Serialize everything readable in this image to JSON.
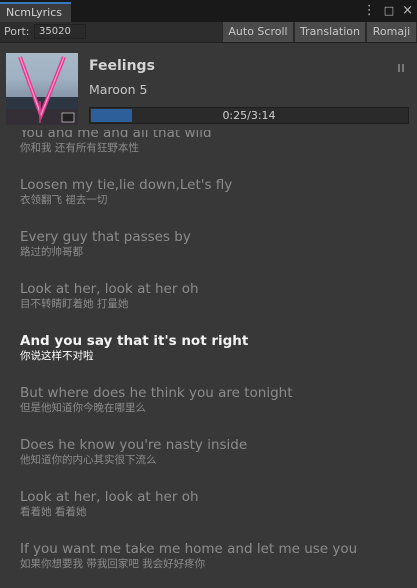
{
  "window": {
    "tab_title": "NcmLyrics"
  },
  "tab_tools": [
    "⋮",
    "□",
    "×"
  ],
  "toolbar": {
    "port_label": "Port:",
    "port_value": "35020",
    "buttons": [
      "Auto Scroll",
      "Translation",
      "Romaji"
    ]
  },
  "song": {
    "title": "Feelings",
    "artist": "Maroon 5",
    "progress_text": "0:25/3:14",
    "progress_fraction": 0.13,
    "cover_icon": "album-cover-art"
  },
  "lyrics": {
    "current_index": 4,
    "lines": [
      {
        "en": "You and me and all that wild",
        "zh": "你和我 还有所有狂野本性"
      },
      {
        "en": "Loosen my tie,lie down,Let's fly",
        "zh": "衣领翻飞 褪去一切"
      },
      {
        "en": "Every guy that passes by",
        "zh": "路过的帅哥都"
      },
      {
        "en": "Look at her, look at her oh",
        "zh": "目不转睛盯着她 打量她"
      },
      {
        "en": "And you say that it's not right",
        "zh": "你说这样不对啦"
      },
      {
        "en": "But where does he think you are tonight",
        "zh": "但是他知道你今晚在哪里么"
      },
      {
        "en": "Does he know you're nasty inside",
        "zh": "他知道你的内心其实很下流么"
      },
      {
        "en": "Look at her, look at her oh",
        "zh": "看着她 看着她"
      },
      {
        "en": "If you want me take me home and let me use you",
        "zh": "如果你想要我 带我回家吧 我会好好疼你"
      }
    ]
  },
  "colors": {
    "accent": "#3a79bb",
    "progress": "#2d5f9a",
    "background": "#383838"
  }
}
